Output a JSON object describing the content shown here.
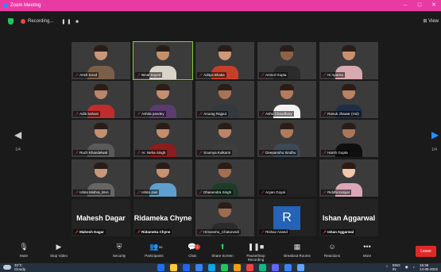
{
  "window": {
    "title": "Zoom Meeting",
    "controls": [
      "–",
      "□",
      "✕"
    ]
  },
  "topbar": {
    "recording_label": "Recording...",
    "pause_stop": "❚❚ ■",
    "view_label": "View"
  },
  "pager": {
    "left_page": "1/4",
    "right_page": "1/4"
  },
  "participants": [
    {
      "name": "Ansh Sood",
      "type": "video",
      "shirt": "#7a5f4a",
      "skin": "#c99778"
    },
    {
      "name": "Binal Sayed",
      "type": "video",
      "active": true,
      "shirt": "#d9d4c8",
      "skin": "#c58f6b"
    },
    {
      "name": "Aditya Bhatia",
      "type": "video",
      "shirt": "#c53f2a",
      "skin": "#d09876"
    },
    {
      "name": "Anmol Gupta",
      "type": "video",
      "shirt": "#2b2b2b",
      "skin": "#8f6247"
    },
    {
      "name": "Hi Aparna",
      "type": "video",
      "shirt": "#d8a9b0",
      "skin": "#c9906f"
    },
    {
      "name": "Aditi Sahani",
      "type": "video",
      "shirt": "#c12c2c",
      "skin": "#b8866a"
    },
    {
      "name": "Ashita pandey",
      "type": "video",
      "shirt": "#5b3c6e",
      "skin": "#c48e70"
    },
    {
      "name": "Anurag Rajput",
      "type": "video",
      "shirt": "#33393f",
      "skin": "#a77556"
    },
    {
      "name": "Ashu Chaudhary",
      "type": "video",
      "shirt": "#f2f2f2",
      "skin": "#b47c5c"
    },
    {
      "name": "Ranuk Jhawar (Hol)",
      "type": "video",
      "shirt": "#1f2e45",
      "skin": "#b98262"
    },
    {
      "name": "Ruch Khandelwal",
      "type": "video",
      "shirt": "#5a5a5a",
      "skin": "#c28f70"
    },
    {
      "name": "Ar. Neha Singh",
      "type": "video",
      "shirt": "#8a1d1d",
      "skin": "#c48d6c"
    },
    {
      "name": "Soumya Kulkarni",
      "type": "video",
      "shirt": "#3e3e3e",
      "skin": "#b98566"
    },
    {
      "name": "Deepanshu Sindhu",
      "type": "video",
      "shirt": "#3c4a56",
      "skin": "#b07b5b"
    },
    {
      "name": "Harsh Gupta",
      "type": "video",
      "shirt": "#0f0f0f",
      "skin": "#a9775a"
    },
    {
      "name": "Ishita Mishra_8AA",
      "type": "video",
      "shirt": "#666",
      "skin": "#c7987c"
    },
    {
      "name": "Ishita Jain",
      "type": "video",
      "shirt": "#5da0d0",
      "skin": "#c9916f"
    },
    {
      "name": "Dhanendra Singh",
      "type": "video",
      "shirt": "#1d3b2a",
      "skin": "#a36f50"
    },
    {
      "name": "Aryan Goyal",
      "type": "off"
    },
    {
      "name": "Riddhi Katiyar",
      "type": "video",
      "shirt": "#dba6b8",
      "skin": "#f0c7a8"
    },
    {
      "name": "Mahesh Dagar",
      "type": "text",
      "label": "Mahesh Dagar"
    },
    {
      "name": "Ridameka Chyne",
      "type": "text",
      "label": "Ridameka Chyne"
    },
    {
      "name": "Himanshu_Chaturvedi",
      "type": "video",
      "shirt": "#2a2a2a",
      "skin": "#9e6c4f"
    },
    {
      "name": "Rishav Anand",
      "type": "letter",
      "label": "R"
    },
    {
      "name": "Ishan Aggarwal",
      "type": "text",
      "label": "Ishan Aggarwal"
    }
  ],
  "toolbar": {
    "items": [
      {
        "label": "Mute",
        "icon": "🎙",
        "name": "mute-button"
      },
      {
        "label": "Stop Video",
        "icon": "▶",
        "name": "stop-video-button"
      },
      {
        "label": "Security",
        "icon": "⛨",
        "name": "security-button"
      },
      {
        "label": "Participants",
        "icon": "👥",
        "count": "56",
        "name": "participants-button"
      },
      {
        "label": "Chat",
        "icon": "💬",
        "badge": "2",
        "name": "chat-button"
      },
      {
        "label": "Share Screen",
        "icon": "⬆",
        "name": "share-screen-button",
        "green": true
      },
      {
        "label": "Pause/Stop Recording",
        "icon": "❚❚■",
        "name": "recording-button"
      },
      {
        "label": "Breakout Rooms",
        "icon": "▦",
        "name": "breakout-rooms-button"
      },
      {
        "label": "Reactions",
        "icon": "☺",
        "name": "reactions-button"
      },
      {
        "label": "More",
        "icon": "•••",
        "name": "more-button"
      }
    ],
    "leave_label": "Leave"
  },
  "taskbar": {
    "weather_temp": "33°C",
    "weather_desc": "Cloudy",
    "lang": "ENG",
    "lang_sub": "IN",
    "time": "15:36",
    "date": "14-05-2022",
    "icon_colors": [
      "#1f6feb",
      "#ffcc33",
      "#2563eb",
      "#3b82f6",
      "#0ea5e9",
      "#22c55e",
      "#f59e0b",
      "#ef4444",
      "#10b981",
      "#6366f1",
      "#3b82f6",
      "#60a5fa"
    ]
  }
}
